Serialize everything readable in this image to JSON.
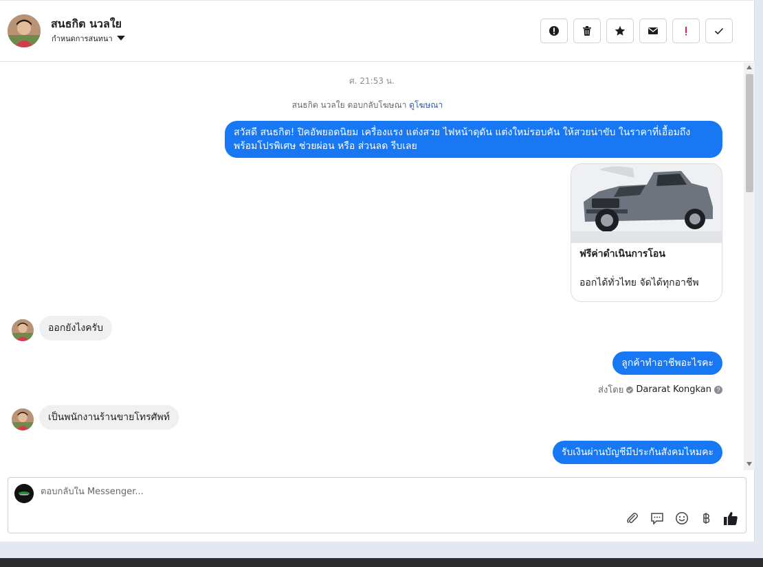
{
  "header": {
    "contact_name": "สนธกิต นวลใย",
    "assign_label": "กำหนดการสนทนา"
  },
  "toolbar": [
    {
      "name": "spam-button",
      "icon": "alert-circle-icon"
    },
    {
      "name": "delete-button",
      "icon": "trash-icon"
    },
    {
      "name": "star-button",
      "icon": "star-icon"
    },
    {
      "name": "mark-unread-button",
      "icon": "envelope-icon"
    },
    {
      "name": "follow-up-button",
      "icon": "exclamation-icon"
    },
    {
      "name": "mark-done-button",
      "icon": "check-icon"
    }
  ],
  "conversation": {
    "timestamp": "ศ. 21:53 น.",
    "system_line": "สนธกิต นวลใย ตอบกลับโฆษณา",
    "system_link": "ดูโฆษณา",
    "messages": [
      {
        "from": "page",
        "text": "สวัสดี สนธกิต! ปิคอัพยอดนิยม เครื่องแรง แต่งสวย ไฟหน้าดุดัน แต่งใหม่รอบคัน ให้สวยน่าขับ ในราคาที่เอื้อมถึง พร้อมโปรพิเศษ ช่วยผ่อน หรือ ส่วนลด รีบเลย"
      },
      {
        "from": "user",
        "text": "ออกยังไงครับ"
      },
      {
        "from": "page",
        "text": "ลูกค้าทำอาชีพอะไรคะ"
      },
      {
        "from": "user",
        "text": "เป็นพนักงานร้านขายโทรศัพท์"
      },
      {
        "from": "page",
        "text": "รับเงินผ่านบัญชีมีประกันสังคมไหมคะ"
      }
    ],
    "ad_card": {
      "title": "ฟรีค่าดำเนินการโอน",
      "description": "ออกได้ทั่วไทย จัดได้ทุกอาชีพ"
    },
    "sent_by_label": "ส่งโดย",
    "sent_by_name": "Dararat Kongkan"
  },
  "composer": {
    "placeholder": "ตอบกลับใน Messenger..."
  },
  "colors": {
    "accent": "#1877f2",
    "incoming_bubble": "#f0f0f0"
  }
}
